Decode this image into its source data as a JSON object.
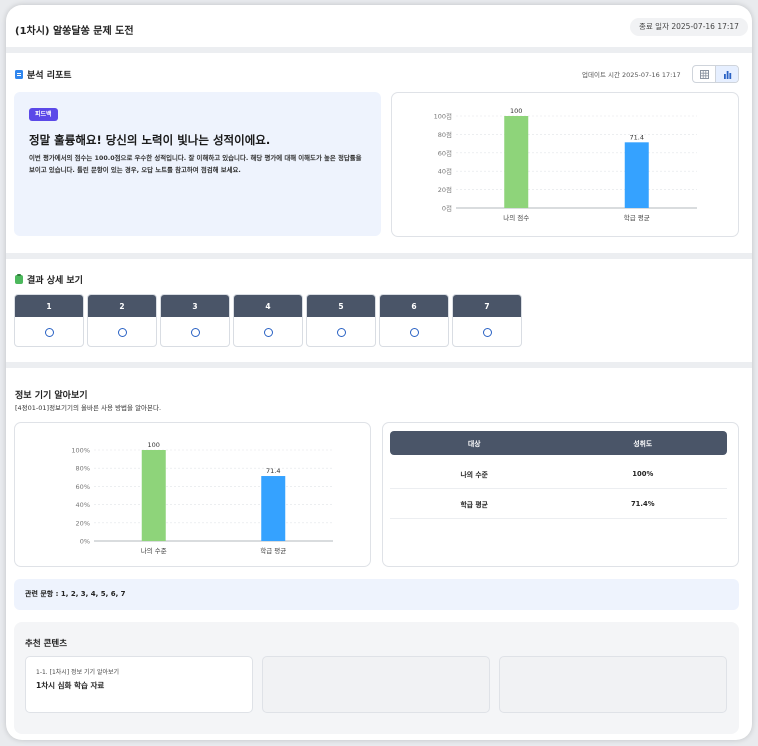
{
  "header": {
    "title": "(1차시) 알쏭달쏭 문제 도전",
    "end_date": "종료 일자 2025-07-16 17:17"
  },
  "report": {
    "title": "분석 리포트",
    "updated": "업데이트 시간 2025-07-16 17:17",
    "view_options": [
      "table-view",
      "chart-view"
    ],
    "active_view": "chart-view",
    "feedback": {
      "badge": "피드백",
      "headline": "정말 훌륭해요! 당신의 노력이 빛나는 성적이에요.",
      "body": "이번 평가에서의 점수는 100.0점으로 우수한 성적입니다. 잘 이해하고 있습니다. 해당 평가에 대해 이해도가 높은 정답률을 보이고 있습니다. 틀린 문항이 있는 경우, 오답 노트를 참고하여 점검해 보세요."
    }
  },
  "results": {
    "title": "결과 상세 보기",
    "questions": [
      {
        "number": "1",
        "result": "correct"
      },
      {
        "number": "2",
        "result": "correct"
      },
      {
        "number": "3",
        "result": "correct"
      },
      {
        "number": "4",
        "result": "correct"
      },
      {
        "number": "5",
        "result": "correct"
      },
      {
        "number": "6",
        "result": "correct"
      },
      {
        "number": "7",
        "result": "correct"
      }
    ]
  },
  "info": {
    "title": "정보 기기 알아보기",
    "standard": "[4정01-01]정보기기의 올바른 사용 방법을 알아본다.",
    "table": {
      "headers": [
        "대상",
        "성취도"
      ],
      "rows": [
        [
          "나의 수준",
          "100%"
        ],
        [
          "학급 평균",
          "71.4%"
        ]
      ]
    },
    "related": "관련 문항 : 1, 2, 3, 4, 5, 6, 7"
  },
  "recommend": {
    "title": "추천 콘텐츠",
    "items": [
      {
        "crumb": "1-1. [1차시] 정보 기기 알아보기",
        "name": "1차시 심화 학습 자료"
      }
    ]
  },
  "colors": {
    "mine": "#8ed47a",
    "average": "#35a2ff",
    "header_bar": "#4a5568",
    "badge": "#5b49e8"
  },
  "chart_data": [
    {
      "type": "bar",
      "categories": [
        "나의 점수",
        "학급 평균"
      ],
      "values": [
        100,
        71.4
      ],
      "data_labels": [
        "100",
        "71.4"
      ],
      "tick_labels": [
        "0점",
        "20점",
        "40점",
        "60점",
        "80점",
        "100점"
      ],
      "ylim": [
        0,
        100
      ],
      "grid": true
    },
    {
      "type": "bar",
      "categories": [
        "나의 수준",
        "학급 평균"
      ],
      "values": [
        100,
        71.4
      ],
      "data_labels": [
        "100",
        "71.4"
      ],
      "tick_labels": [
        "0%",
        "20%",
        "40%",
        "60%",
        "80%",
        "100%"
      ],
      "ylim": [
        0,
        100
      ],
      "grid": true
    }
  ]
}
